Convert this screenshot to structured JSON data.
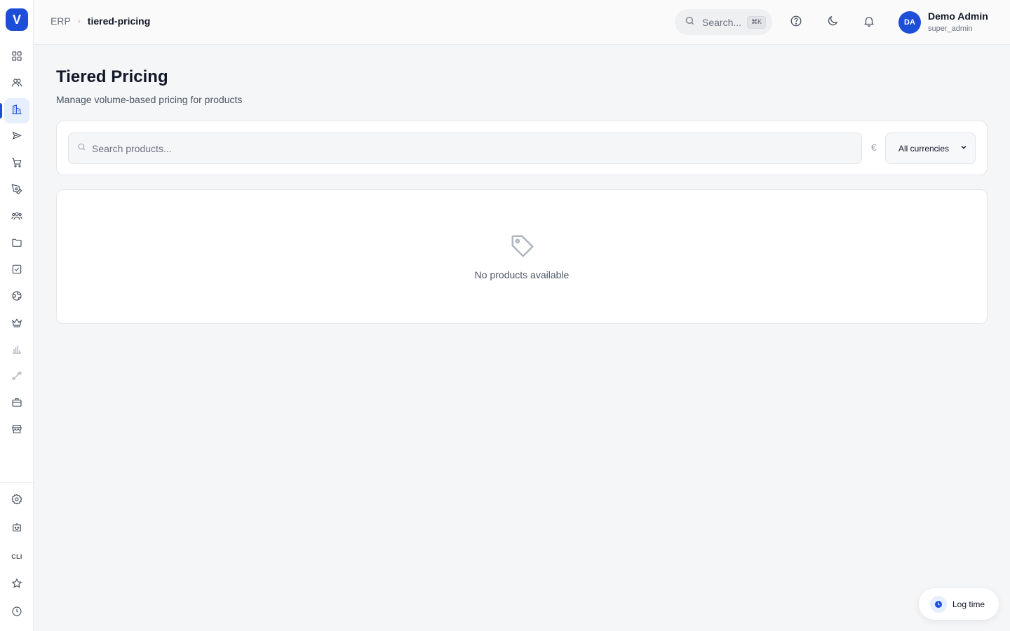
{
  "app": {
    "logo_letter": "V"
  },
  "breadcrumb": {
    "root": "ERP",
    "separator": "›",
    "current": "tiered-pricing"
  },
  "header": {
    "search_placeholder": "Search...",
    "search_shortcut": "⌘K",
    "icons": [
      "help-circle-icon",
      "moon-icon",
      "bell-icon"
    ]
  },
  "user": {
    "initials": "DA",
    "name": "Demo Admin",
    "role": "super_admin"
  },
  "sidebar": {
    "items": [
      {
        "icon": "dashboard-grid-icon"
      },
      {
        "icon": "users-icon"
      },
      {
        "icon": "building-icon",
        "active": true
      },
      {
        "icon": "send-icon"
      },
      {
        "icon": "shopping-cart-icon"
      },
      {
        "icon": "pen-tool-icon"
      },
      {
        "icon": "team-icon"
      },
      {
        "icon": "folder-icon"
      },
      {
        "icon": "check-square-icon"
      },
      {
        "icon": "globe-icon"
      },
      {
        "icon": "crown-icon"
      },
      {
        "icon": "bar-chart-icon"
      },
      {
        "icon": "route-icon"
      },
      {
        "icon": "briefcase-icon"
      },
      {
        "icon": "store-icon"
      }
    ],
    "bottom_items": [
      {
        "icon": "settings-icon"
      },
      {
        "icon": "bot-icon"
      },
      {
        "label": "CLI"
      },
      {
        "icon": "star-icon"
      },
      {
        "icon": "clock-icon"
      }
    ]
  },
  "page": {
    "title": "Tiered Pricing",
    "subtitle": "Manage volume-based pricing for products"
  },
  "filters": {
    "search_placeholder": "Search products...",
    "search_value": "",
    "currency_symbol": "€",
    "currency_selected": "All currencies"
  },
  "empty_state": {
    "icon": "tag-icon",
    "message": "No products available"
  },
  "log_time": {
    "label": "Log time"
  },
  "colors": {
    "accent": "#1d4ed8",
    "background": "#f5f6f8",
    "card": "#ffffff"
  }
}
